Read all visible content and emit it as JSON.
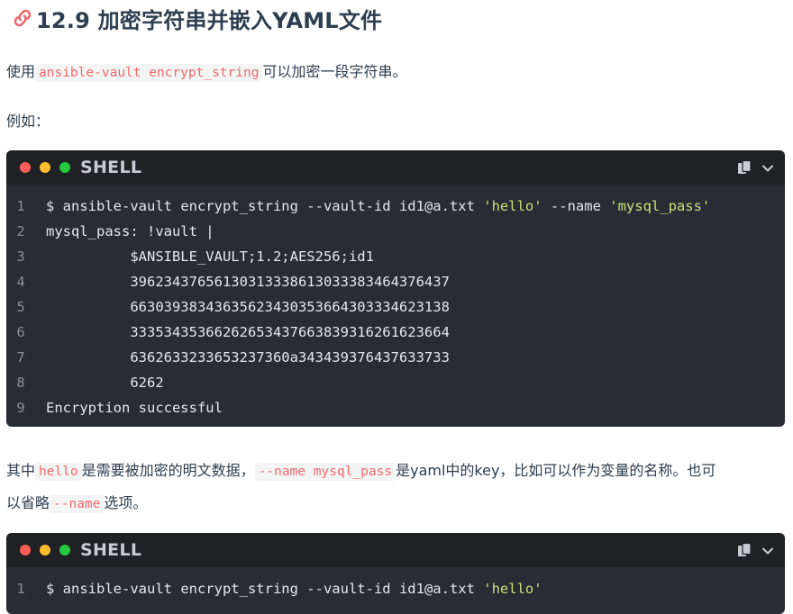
{
  "heading": {
    "text": "12.9 加密字符串并嵌入YAML文件"
  },
  "para1": {
    "before": "使用",
    "code": "ansible-vault encrypt_string",
    "after": "可以加密一段字符串。"
  },
  "para2": {
    "text": "例如："
  },
  "code1": {
    "lang": "SHELL",
    "lines": [
      {
        "num": "1",
        "parts": [
          {
            "t": "$ ",
            "c": "prompt"
          },
          {
            "t": "ansible-vault encrypt_string --vault-id id1@a.txt ",
            "c": ""
          },
          {
            "t": "'hello'",
            "c": "str"
          },
          {
            "t": " --name ",
            "c": ""
          },
          {
            "t": "'mysql_pass'",
            "c": "str"
          }
        ]
      },
      {
        "num": "2",
        "parts": [
          {
            "t": "mysql_pass: !vault |",
            "c": ""
          }
        ]
      },
      {
        "num": "3",
        "parts": [
          {
            "t": "          $ANSIBLE_VAULT;1.2;AES256;id1",
            "c": ""
          }
        ]
      },
      {
        "num": "4",
        "parts": [
          {
            "t": "          39623437656130313338613033383464376437",
            "c": ""
          }
        ]
      },
      {
        "num": "5",
        "parts": [
          {
            "t": "          66303938343635623430353664303334623138",
            "c": ""
          }
        ]
      },
      {
        "num": "6",
        "parts": [
          {
            "t": "          33353435366262653437663839316261623664",
            "c": ""
          }
        ]
      },
      {
        "num": "7",
        "parts": [
          {
            "t": "          6362633233653237360a343439376437633733",
            "c": ""
          }
        ]
      },
      {
        "num": "8",
        "parts": [
          {
            "t": "          6262",
            "c": ""
          }
        ]
      },
      {
        "num": "9",
        "parts": [
          {
            "t": "Encryption successful",
            "c": ""
          }
        ]
      }
    ]
  },
  "para3": {
    "s1": "其中",
    "c1": "hello",
    "s2": "是需要被加密的明文数据，",
    "c2": "--name mysql_pass",
    "s3": "是yaml中的key，比如可以作为变量的名称。也可",
    "s4": "以省略",
    "c3": "--name",
    "s5": "选项。"
  },
  "code2": {
    "lang": "SHELL",
    "lines": [
      {
        "num": "1",
        "parts": [
          {
            "t": "$ ",
            "c": "prompt"
          },
          {
            "t": "ansible-vault encrypt_string --vault-id id1@a.txt ",
            "c": ""
          },
          {
            "t": "'hello'",
            "c": "str"
          }
        ]
      }
    ]
  },
  "icons": {
    "link": "link-icon",
    "copy": "copy-icon",
    "fold": "chevron-down-icon"
  },
  "colors": {
    "accent": "#ee6a6a",
    "code_bg": "#282c34",
    "string": "#c5e478"
  }
}
